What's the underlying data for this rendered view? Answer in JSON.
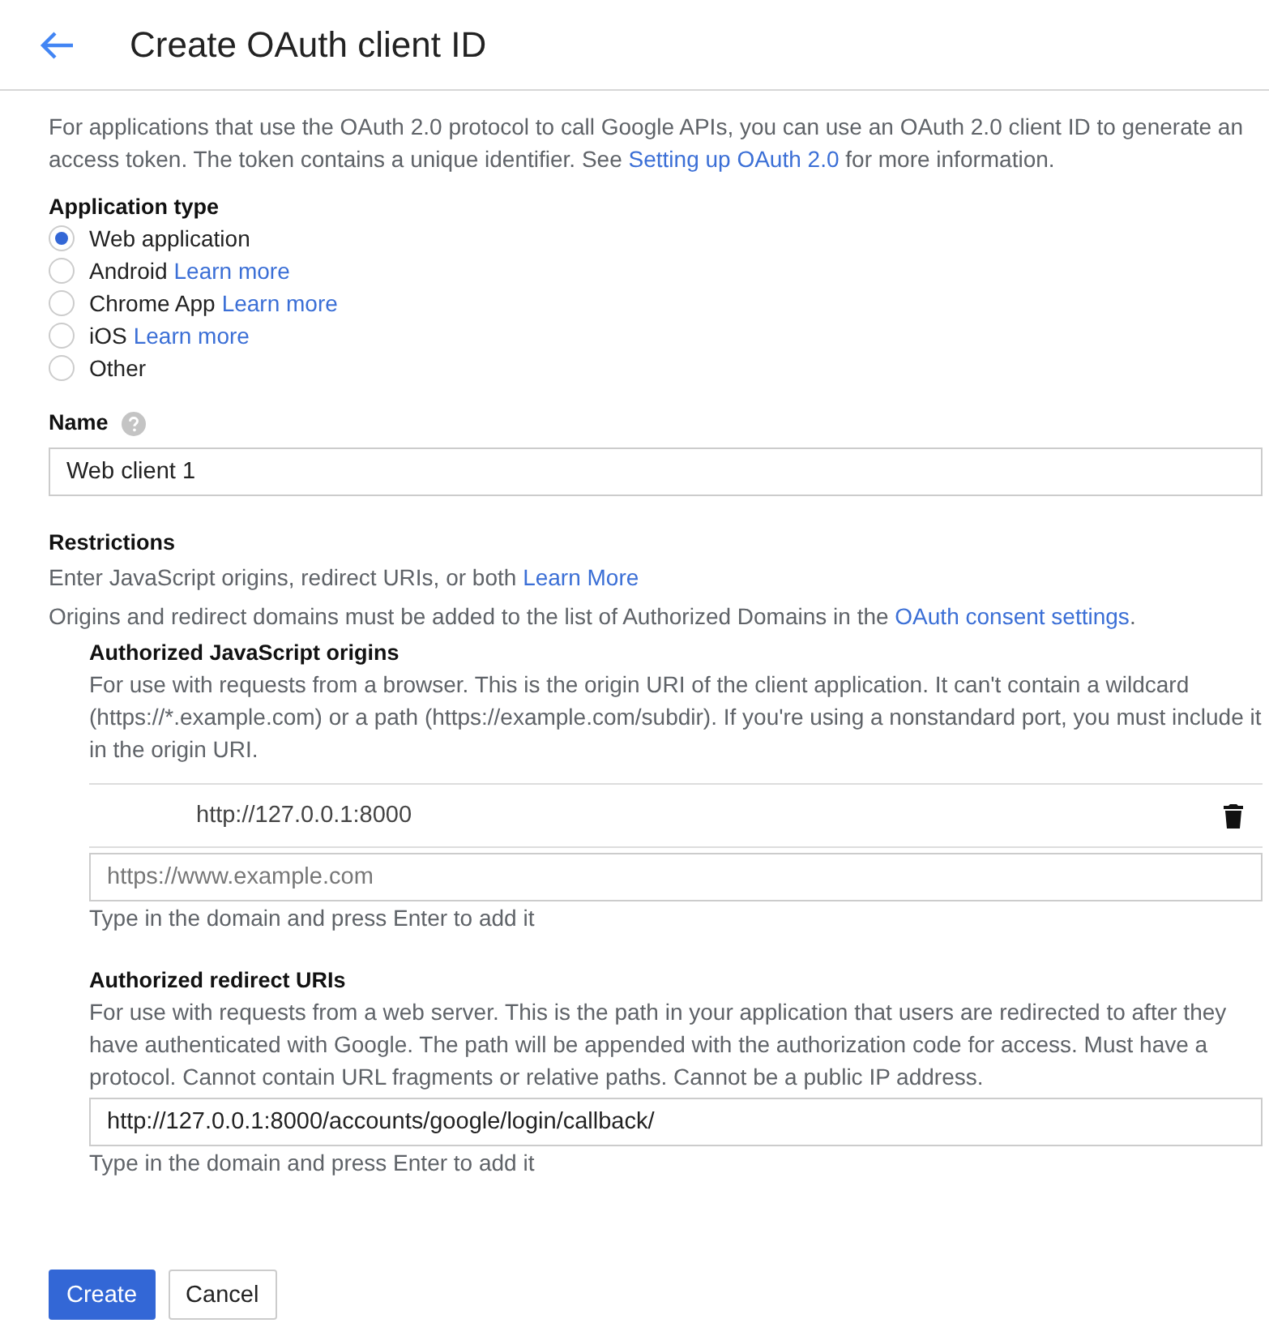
{
  "header": {
    "title": "Create OAuth client ID"
  },
  "intro": {
    "before": "For applications that use the OAuth 2.0 protocol to call Google APIs, you can use an OAuth 2.0 client ID to generate an access token. The token contains a unique identifier. See ",
    "link": "Setting up OAuth 2.0",
    "after": " for more information."
  },
  "application_type": {
    "label": "Application type",
    "options": [
      {
        "label": "Web application",
        "selected": true
      },
      {
        "label": "Android",
        "link": "Learn more",
        "selected": false
      },
      {
        "label": "Chrome App",
        "link": "Learn more",
        "selected": false
      },
      {
        "label": "iOS",
        "link": "Learn more",
        "selected": false
      },
      {
        "label": "Other",
        "selected": false
      }
    ]
  },
  "name": {
    "label": "Name",
    "value": "Web client 1"
  },
  "restrictions": {
    "title": "Restrictions",
    "hint": {
      "before": "Enter JavaScript origins, redirect URIs, or both ",
      "link": "Learn More"
    },
    "note": {
      "before": "Origins and redirect domains must be added to the list of Authorized Domains in the ",
      "link": "OAuth consent settings",
      "after": "."
    }
  },
  "origins": {
    "title": "Authorized JavaScript origins",
    "description": "For use with requests from a browser. This is the origin URI of the client application. It can't contain a wildcard (https://*.example.com) or a path (https://example.com/subdir). If you're using a nonstandard port, you must include it in the origin URI.",
    "entries": [
      "http://127.0.0.1:8000"
    ],
    "placeholder": "https://www.example.com",
    "help": "Type in the domain and press Enter to add it"
  },
  "redirects": {
    "title": "Authorized redirect URIs",
    "description": "For use with requests from a web server. This is the path in your application that users are redirected to after they have authenticated with Google. The path will be appended with the authorization code for access. Must have a protocol. Cannot contain URL fragments or relative paths. Cannot be a public IP address.",
    "value": "http://127.0.0.1:8000/accounts/google/login/callback/",
    "help": "Type in the domain and press Enter to add it"
  },
  "buttons": [
    {
      "label": "Create",
      "kind": "primary"
    },
    {
      "label": "Cancel",
      "kind": "secondary"
    }
  ]
}
